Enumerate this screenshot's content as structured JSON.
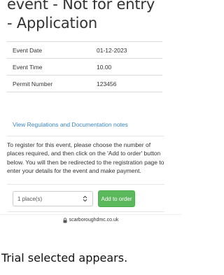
{
  "event": {
    "title_line1": "event - Not for entry",
    "title_line2": "- Application"
  },
  "details": {
    "rows": [
      {
        "label": "Event Date",
        "value": "01-12-2023"
      },
      {
        "label": "Event Time",
        "value": "10.00"
      },
      {
        "label": "Permit Number",
        "value": "123456"
      }
    ]
  },
  "links": {
    "regulations": "View Regulations and Documentation notes"
  },
  "instructions": {
    "text": "To register for this event, please choose the number of places required, and then click on the 'Add to order' button below. You will then be redirected to the registration page to enter your details for the event and make payment."
  },
  "order": {
    "places_selected": "1 place(s)",
    "add_button_label": "Add to order",
    "add_button_color": "#5cb85c"
  },
  "browser": {
    "url": "scarboroughdmc.co.uk"
  },
  "caption": {
    "text": "Trial selected appears."
  },
  "colors": {
    "link": "#3a87c8",
    "text": "#333333",
    "border": "#dddddd"
  }
}
